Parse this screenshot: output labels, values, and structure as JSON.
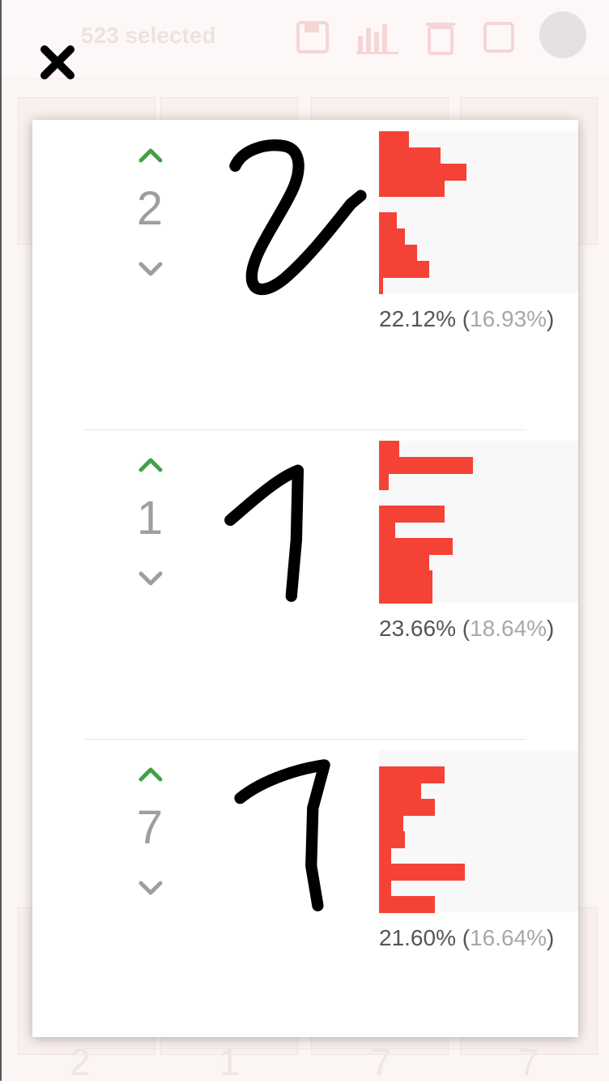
{
  "header": {
    "selected_label": "523 selected",
    "icons": [
      "save-icon",
      "bar-chart-icon",
      "trash-icon",
      "checkbox-icon",
      "avatar"
    ]
  },
  "modal": {
    "close_icon": "close-icon",
    "items": [
      {
        "label": "2",
        "primary_pct": "22.12%",
        "secondary_pct": "16.93%",
        "histogram": [
          0.15,
          0.31,
          0.44,
          0.33,
          0,
          0.09,
          0.13,
          0.19,
          0.25,
          0.02
        ]
      },
      {
        "label": "1",
        "primary_pct": "23.66%",
        "secondary_pct": "18.64%",
        "histogram": [
          0.1,
          0.47,
          0.05,
          0,
          0.33,
          0.08,
          0.37,
          0.25,
          0.27,
          0.27
        ]
      },
      {
        "label": "7",
        "primary_pct": "21.60%",
        "secondary_pct": "16.64%",
        "histogram": [
          0,
          0.33,
          0.21,
          0.28,
          0.12,
          0.13,
          0.06,
          0.43,
          0.06,
          0.28
        ]
      }
    ]
  },
  "background": {
    "bottom_labels": [
      "2",
      "1",
      "7",
      "7"
    ]
  },
  "colors": {
    "vote_up": "#43a047",
    "vote_down": "#9e9e9e",
    "bar": "#f44336",
    "hist_bg": "#f8f8f8"
  }
}
